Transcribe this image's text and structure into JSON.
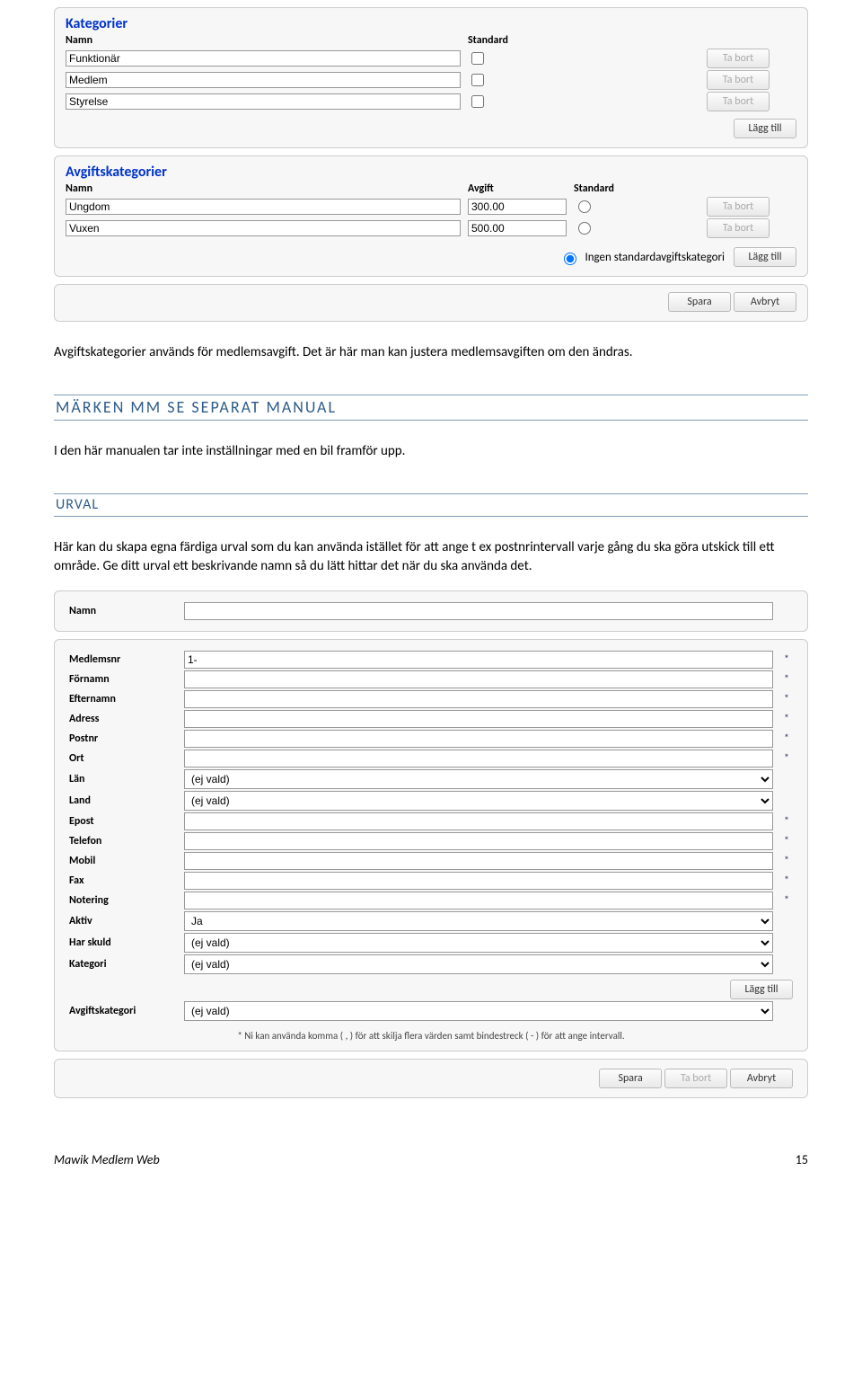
{
  "kategorier": {
    "title": "Kategorier",
    "header_namn": "Namn",
    "header_std": "Standard",
    "rows": [
      {
        "namn": "Funktionär"
      },
      {
        "namn": "Medlem"
      },
      {
        "namn": "Styrelse"
      }
    ],
    "delete_label": "Ta bort",
    "add_label": "Lägg till"
  },
  "avgiftskategorier": {
    "title": "Avgiftskategorier",
    "header_namn": "Namn",
    "header_avgift": "Avgift",
    "header_std": "Standard",
    "rows": [
      {
        "namn": "Ungdom",
        "avgift": "300.00"
      },
      {
        "namn": "Vuxen",
        "avgift": "500.00"
      }
    ],
    "no_default_label": "Ingen standardavgiftskategori",
    "delete_label": "Ta bort",
    "add_label": "Lägg till"
  },
  "save_cancel": {
    "save": "Spara",
    "cancel": "Avbryt"
  },
  "paragraph1": "Avgiftskategorier används för medlemsavgift. Det är här man kan justera medlemsavgiften om den ändras.",
  "heading_marken": "MÄRKEN MM SE SEPARAT MANUAL",
  "paragraph2": "I den här manualen tar inte inställningar med en bil framför upp.",
  "heading_urval": "URVAL",
  "paragraph3": "Här kan du skapa egna färdiga urval som du kan använda istället för att ange t ex postnrintervall varje gång du ska göra utskick till ett område. Ge ditt urval ett beskrivande namn så du lätt hittar det när du ska använda det.",
  "urval_form": {
    "label_namn": "Namn",
    "hint": "* Ni kan använda komma ( , ) för att skilja flera värden samt bindestreck ( - ) för att ange intervall.",
    "add_label": "Lägg till",
    "delete_label": "Ta bort",
    "fields": [
      {
        "label": "Medlemsnr",
        "type": "text",
        "value": "1-",
        "star": true
      },
      {
        "label": "Förnamn",
        "type": "text",
        "value": "",
        "star": true
      },
      {
        "label": "Efternamn",
        "type": "text",
        "value": "",
        "star": true
      },
      {
        "label": "Adress",
        "type": "text",
        "value": "",
        "star": true
      },
      {
        "label": "Postnr",
        "type": "text",
        "value": "",
        "star": true
      },
      {
        "label": "Ort",
        "type": "text",
        "value": "",
        "star": true
      },
      {
        "label": "Län",
        "type": "select",
        "value": "(ej vald)",
        "star": false
      },
      {
        "label": "Land",
        "type": "select",
        "value": "(ej vald)",
        "star": false
      },
      {
        "label": "Epost",
        "type": "text",
        "value": "",
        "star": true
      },
      {
        "label": "Telefon",
        "type": "text",
        "value": "",
        "star": true
      },
      {
        "label": "Mobil",
        "type": "text",
        "value": "",
        "star": true
      },
      {
        "label": "Fax",
        "type": "text",
        "value": "",
        "star": true
      },
      {
        "label": "Notering",
        "type": "text",
        "value": "",
        "star": true
      },
      {
        "label": "Aktiv",
        "type": "select",
        "value": "Ja",
        "star": false
      },
      {
        "label": "Har skuld",
        "type": "select",
        "value": "(ej vald)",
        "star": false
      },
      {
        "label": "Kategori",
        "type": "select",
        "value": "(ej vald)",
        "star": false
      }
    ],
    "avgiftskategori": {
      "label": "Avgiftskategori",
      "value": "(ej vald)"
    }
  },
  "footer": {
    "left": "Mawik Medlem Web",
    "right": "15"
  }
}
